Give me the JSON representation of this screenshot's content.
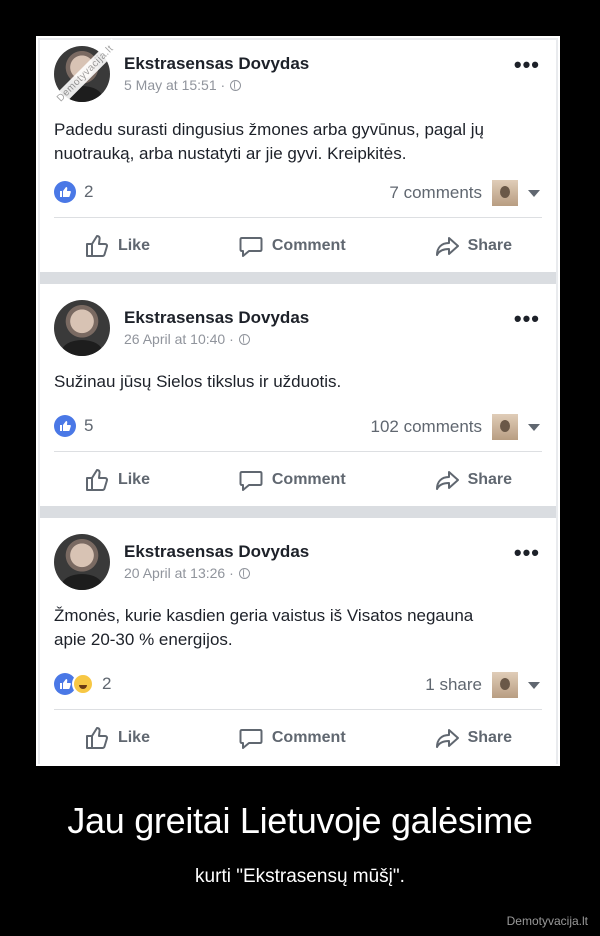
{
  "watermark": "Demotyvacija.lt",
  "posts": [
    {
      "author": "Ekstrasensas Dovydas",
      "date": "5 May at 15:51 ·",
      "text": "Padedu surasti dingusius žmones arba gyvūnus, pagal jų nuotrauką, arba nustatyti ar jie gyvi. Kreipkitės.",
      "reactions": "2",
      "counts": "7 comments",
      "reaction_icons": [
        "like-icon"
      ]
    },
    {
      "author": "Ekstrasensas Dovydas",
      "date": "26 April at 10:40 ·",
      "text": "Sužinau jūsų Sielos tikslus ir užduotis.",
      "reactions": "5",
      "counts": "102 comments",
      "reaction_icons": [
        "like-icon"
      ]
    },
    {
      "author": "Ekstrasensas Dovydas",
      "date": "20 April at 13:26 ·",
      "text": "Žmonės, kurie kasdien geria vaistus iš Visatos negauna apie 20-30 % energijos.",
      "reactions": "2",
      "counts": "1 share",
      "reaction_icons": [
        "like-icon",
        "haha-icon"
      ]
    }
  ],
  "actions": {
    "like": "Like",
    "comment": "Comment",
    "share": "Share"
  },
  "caption": {
    "title": "Jau greitai Lietuvoje galėsime",
    "subtitle": "kurti \"Ekstrasensų mūšį\"."
  },
  "site": "Demotyvacija.lt",
  "colors": {
    "like_blue": "#4a78e6",
    "haha_yellow": "#f7c744",
    "text": "#1d2129",
    "muted": "#606770"
  }
}
